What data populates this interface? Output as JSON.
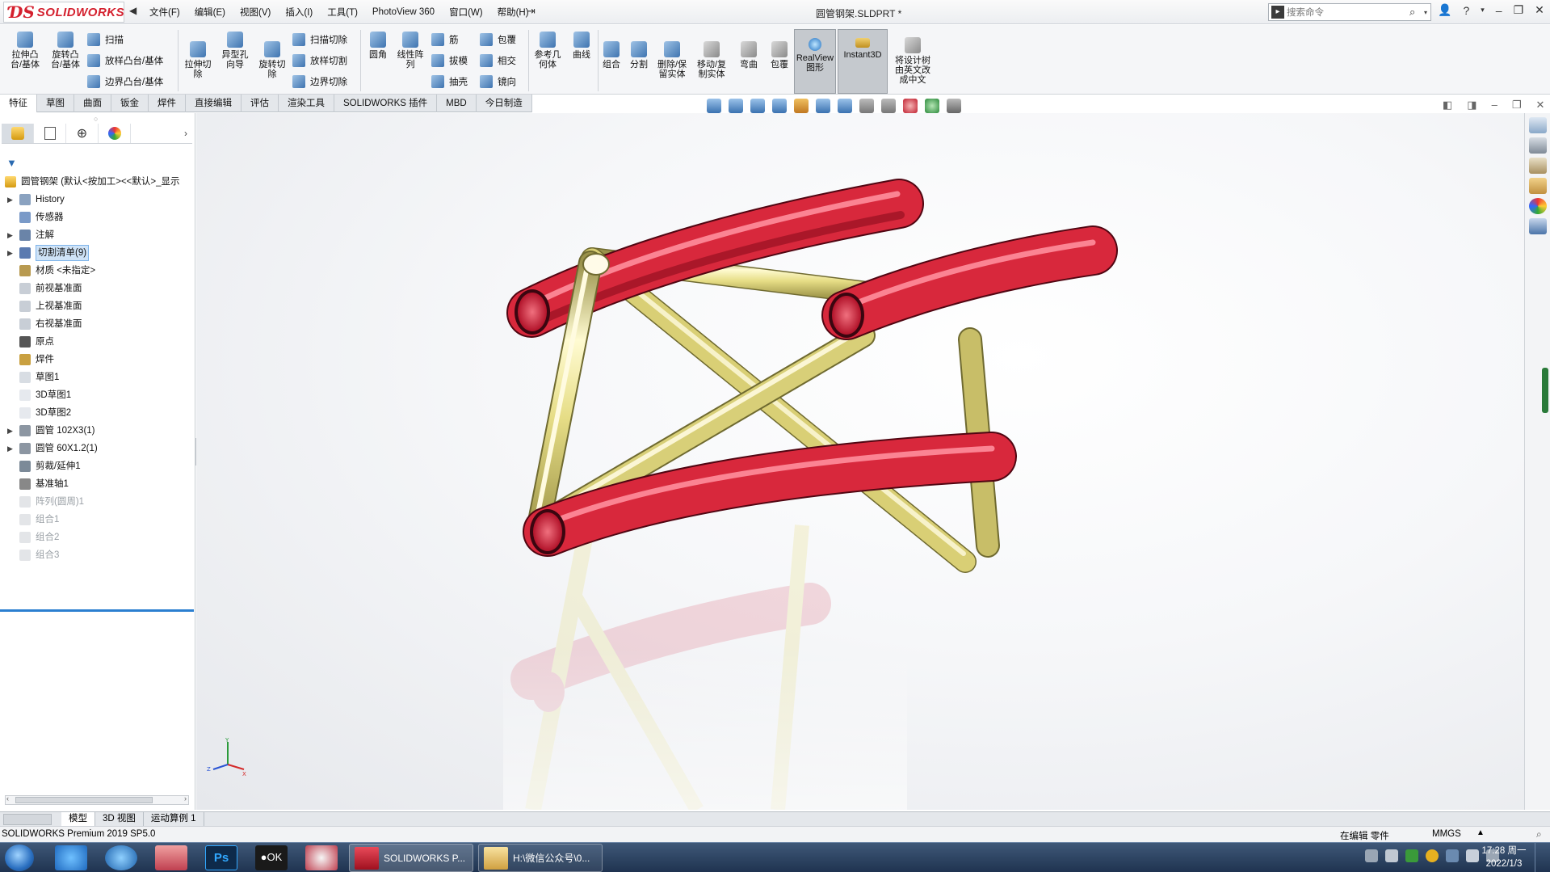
{
  "app": {
    "logo_text": "SOLIDWORKS",
    "title": "圆管钢架.SLDPRT *"
  },
  "menubar": [
    "文件(F)",
    "编辑(E)",
    "视图(V)",
    "插入(I)",
    "工具(T)",
    "PhotoView 360",
    "窗口(W)",
    "帮助(H)"
  ],
  "search": {
    "placeholder": "搜索命令"
  },
  "command_manager": {
    "large_buttons": [
      {
        "label": "拉伸凸\n台/基体",
        "icon": "extrude-boss-icon"
      },
      {
        "label": "旋转凸\n台/基体",
        "icon": "revolve-boss-icon"
      },
      {
        "label": "拉伸切\n除",
        "icon": "extrude-cut-icon"
      },
      {
        "label": "异型孔\n向导",
        "icon": "hole-wizard-icon"
      },
      {
        "label": "旋转切\n除",
        "icon": "revolve-cut-icon"
      },
      {
        "label": "圆角",
        "icon": "fillet-icon"
      },
      {
        "label": "线性阵\n列",
        "icon": "linear-pattern-icon"
      },
      {
        "label": "参考几\n何体",
        "icon": "reference-geometry-icon"
      },
      {
        "label": "曲线",
        "icon": "curves-icon"
      },
      {
        "label": "组合",
        "icon": "combine-icon"
      },
      {
        "label": "分割",
        "icon": "split-icon"
      },
      {
        "label": "删除/保\n留实体",
        "icon": "delete-keep-body-icon"
      },
      {
        "label": "移动/复\n制实体",
        "icon": "move-copy-body-icon"
      },
      {
        "label": "弯曲",
        "icon": "flex-icon"
      },
      {
        "label": "包覆",
        "icon": "wrap-icon"
      },
      {
        "label": "RealView\n图形",
        "icon": "realview-icon"
      },
      {
        "label": "Instant3D",
        "icon": "instant3d-icon"
      },
      {
        "label": "将设计树\n由英文改\n成中文",
        "icon": "translate-tree-icon"
      }
    ],
    "small_buttons": [
      {
        "label": "扫描",
        "icon": "sweep-icon"
      },
      {
        "label": "放样凸台/基体",
        "icon": "loft-boss-icon"
      },
      {
        "label": "边界凸台/基体",
        "icon": "boundary-boss-icon"
      },
      {
        "label": "扫描切除",
        "icon": "swept-cut-icon"
      },
      {
        "label": "放样切割",
        "icon": "lofted-cut-icon"
      },
      {
        "label": "边界切除",
        "icon": "boundary-cut-icon"
      },
      {
        "label": "筋",
        "icon": "rib-icon"
      },
      {
        "label": "拔模",
        "icon": "draft-icon"
      },
      {
        "label": "抽壳",
        "icon": "shell-icon"
      },
      {
        "label": "包覆",
        "icon": "wrap-small-icon"
      },
      {
        "label": "相交",
        "icon": "intersect-icon"
      },
      {
        "label": "镜向",
        "icon": "mirror-icon"
      }
    ]
  },
  "tabs": [
    "特征",
    "草图",
    "曲面",
    "钣金",
    "焊件",
    "直接编辑",
    "评估",
    "渲染工具",
    "SOLIDWORKS 插件",
    "MBD",
    "今日制造"
  ],
  "active_tab": "特征",
  "feature_tree": {
    "root": "圆管钢架  (默认<按加工><<默认>_显示",
    "nodes": [
      {
        "label": "History",
        "expandable": true,
        "icon": "history-icon"
      },
      {
        "label": "传感器",
        "expandable": false,
        "icon": "sensor-icon"
      },
      {
        "label": "注解",
        "expandable": true,
        "icon": "annotations-icon"
      },
      {
        "label": "切割清单(9)",
        "expandable": true,
        "icon": "cut-list-icon",
        "selected": true
      },
      {
        "label": "材质 <未指定>",
        "expandable": false,
        "icon": "material-icon"
      },
      {
        "label": "前视基准面",
        "expandable": false,
        "icon": "plane-icon"
      },
      {
        "label": "上视基准面",
        "expandable": false,
        "icon": "plane-icon"
      },
      {
        "label": "右视基准面",
        "expandable": false,
        "icon": "plane-icon"
      },
      {
        "label": "原点",
        "expandable": false,
        "icon": "origin-icon"
      },
      {
        "label": "焊件",
        "expandable": false,
        "icon": "weldment-icon"
      },
      {
        "label": "草图1",
        "expandable": false,
        "icon": "sketch-icon"
      },
      {
        "label": "3D草图1",
        "expandable": false,
        "icon": "3d-sketch-icon"
      },
      {
        "label": "3D草图2",
        "expandable": false,
        "icon": "3d-sketch-icon"
      },
      {
        "label": "圆管 102X3(1)",
        "expandable": true,
        "icon": "structural-member-icon"
      },
      {
        "label": "圆管 60X1.2(1)",
        "expandable": true,
        "icon": "structural-member-icon"
      },
      {
        "label": "剪裁/延伸1",
        "expandable": false,
        "icon": "trim-extend-icon"
      },
      {
        "label": "基准轴1",
        "expandable": false,
        "icon": "axis-icon"
      },
      {
        "label": "阵列(圆周)1",
        "expandable": false,
        "icon": "circular-pattern-icon",
        "suppressed": true
      },
      {
        "label": "组合1",
        "expandable": false,
        "icon": "combine-icon",
        "suppressed": true
      },
      {
        "label": "组合2",
        "expandable": false,
        "icon": "combine-icon",
        "suppressed": true
      },
      {
        "label": "组合3",
        "expandable": false,
        "icon": "combine-icon",
        "suppressed": true
      }
    ]
  },
  "model": {
    "tube_red": "#d8283c",
    "tube_yellow": "#e8e08a",
    "background": "#f2f3f6"
  },
  "bottom_tabs": [
    "模型",
    "3D 视图",
    "运动算例 1"
  ],
  "status": {
    "version": "SOLIDWORKS Premium 2019 SP5.0",
    "editing": "在编辑 零件",
    "units": "MMGS"
  },
  "taskbar": {
    "apps": [
      {
        "label": "SOLIDWORKS P...",
        "icon": "solidworks-icon"
      },
      {
        "label": "H:\\微信公众号\\0...",
        "icon": "folder-icon"
      }
    ],
    "clock_time": "17:28 周一",
    "clock_date": "2022/1/3"
  },
  "colors": {
    "accent": "#2b7fd0",
    "brand_red": "#d4202e"
  }
}
